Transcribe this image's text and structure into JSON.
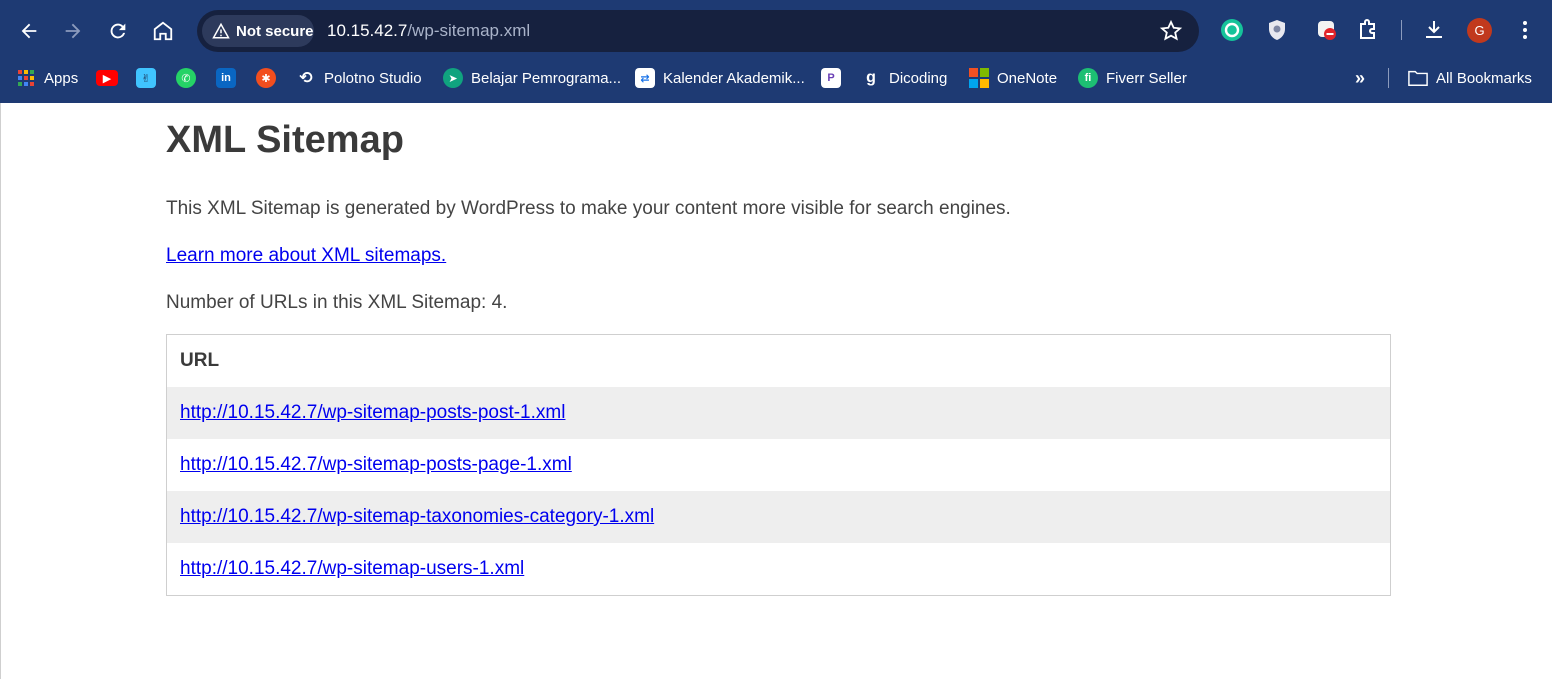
{
  "browser": {
    "security_label": "Not secure",
    "url_host": "10.15.42.7",
    "url_path": "/wp-sitemap.xml",
    "avatar_initial": "G",
    "bookmarks": [
      {
        "label": "Apps",
        "icon": "apps-grid-icon"
      },
      {
        "label": "",
        "icon": "youtube-icon"
      },
      {
        "label": "",
        "icon": "app-icon"
      },
      {
        "label": "",
        "icon": "whatsapp-icon"
      },
      {
        "label": "",
        "icon": "linkedin-icon"
      },
      {
        "label": "",
        "icon": "figma-icon"
      },
      {
        "label": "Polotno Studio",
        "icon": "polotno-icon"
      },
      {
        "label": "Belajar Pemrograma...",
        "icon": "dicoding-academy-icon"
      },
      {
        "label": "Kalender Akademik...",
        "icon": "calendar-icon"
      },
      {
        "label": "",
        "icon": "p-app-icon"
      },
      {
        "label": "Dicoding",
        "icon": "dicoding-icon"
      },
      {
        "label": "OneNote",
        "icon": "microsoft-icon"
      },
      {
        "label": "Fiverr Seller",
        "icon": "fiverr-icon"
      }
    ],
    "all_bookmarks_label": "All Bookmarks"
  },
  "page": {
    "title": "XML Sitemap",
    "description": "This XML Sitemap is generated by WordPress to make your content more visible for search engines.",
    "learn_more": "Learn more about XML sitemaps.",
    "count_text": "Number of URLs in this XML Sitemap: 4.",
    "table": {
      "header": "URL",
      "rows": [
        "http://10.15.42.7/wp-sitemap-posts-post-1.xml",
        "http://10.15.42.7/wp-sitemap-posts-page-1.xml",
        "http://10.15.42.7/wp-sitemap-taxonomies-category-1.xml",
        "http://10.15.42.7/wp-sitemap-users-1.xml"
      ]
    }
  },
  "colors": {
    "chrome_bg": "#1e3a73",
    "omnibox_bg": "#16213f",
    "link": "#0000ee",
    "row_shade": "#eeeeee"
  }
}
